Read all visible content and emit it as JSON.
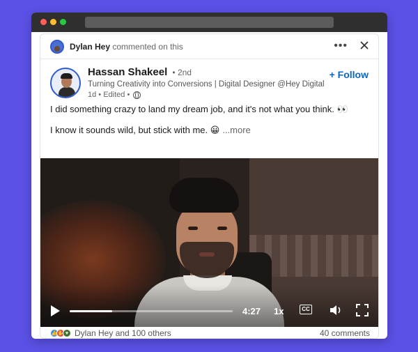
{
  "activity": {
    "actor": "Dylan Hey",
    "action": "commented on this"
  },
  "post": {
    "author": {
      "name": "Hassan Shakeel",
      "degree": "• 2nd",
      "headline": "Turning Creativity into Conversions | Digital Designer @Hey Digital...",
      "meta": "1d • Edited •"
    },
    "follow_label": "+ Follow",
    "text_line1": "I did something crazy to land my dream job, and it's not what you think. 👀",
    "text_line2": "I know it sounds wild, but stick with me. 😀",
    "see_more": "...more"
  },
  "video": {
    "time": "4:27",
    "speed": "1x",
    "cc_label": "CC",
    "progress": 0.26
  },
  "social": {
    "reactions_text": "Dylan Hey and 100 others",
    "comments_text": "40 comments"
  },
  "colors": {
    "background": "#5b51e6",
    "link": "#0a66c2"
  }
}
